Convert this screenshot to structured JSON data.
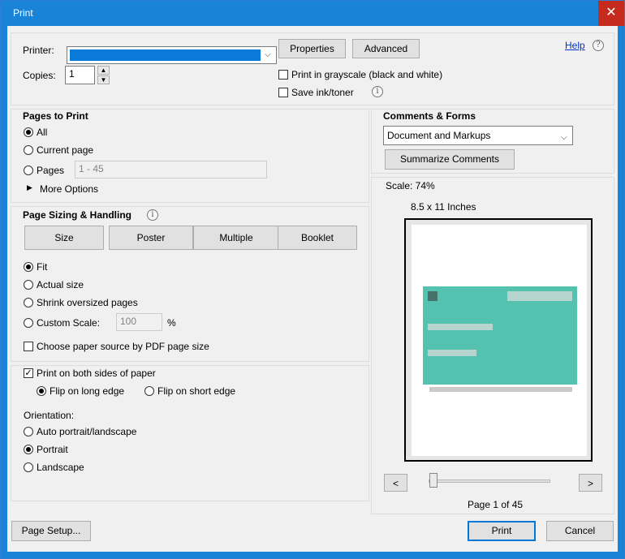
{
  "window": {
    "title": "Print",
    "close": "✕"
  },
  "top": {
    "printer_label": "Printer:",
    "properties_button": "Properties",
    "advanced_button": "Advanced",
    "help_link": "Help",
    "copies_label": "Copies:",
    "copies_value": "1",
    "grayscale_label": "Print in grayscale (black and white)",
    "save_ink_label": "Save ink/toner"
  },
  "pages_to_print": {
    "heading": "Pages to Print",
    "all": "All",
    "current_page": "Current page",
    "pages": "Pages",
    "pages_range": "1 - 45",
    "more_options": "More Options"
  },
  "sizing": {
    "heading": "Page Sizing & Handling",
    "tabs": [
      "Size",
      "Poster",
      "Multiple",
      "Booklet"
    ],
    "fit": "Fit",
    "actual_size": "Actual size",
    "shrink": "Shrink oversized pages",
    "custom_scale": "Custom Scale:",
    "custom_scale_value": "100",
    "percent": "%",
    "paper_source": "Choose paper source by PDF page size"
  },
  "duplex": {
    "both_sides": "Print on both sides of paper",
    "flip_long": "Flip on long edge",
    "flip_short": "Flip on short edge",
    "orientation_label": "Orientation:",
    "auto": "Auto portrait/landscape",
    "portrait": "Portrait",
    "landscape": "Landscape"
  },
  "comments": {
    "heading": "Comments & Forms",
    "selected": "Document and Markups",
    "summarize_button": "Summarize Comments"
  },
  "preview": {
    "scale": "Scale:  74%",
    "paper": "8.5 x 11 Inches",
    "prev": "<",
    "next": ">",
    "page_indicator": "Page 1 of 45",
    "card_color": "#55c2b0"
  },
  "footer": {
    "page_setup": "Page Setup...",
    "print": "Print",
    "cancel": "Cancel"
  }
}
